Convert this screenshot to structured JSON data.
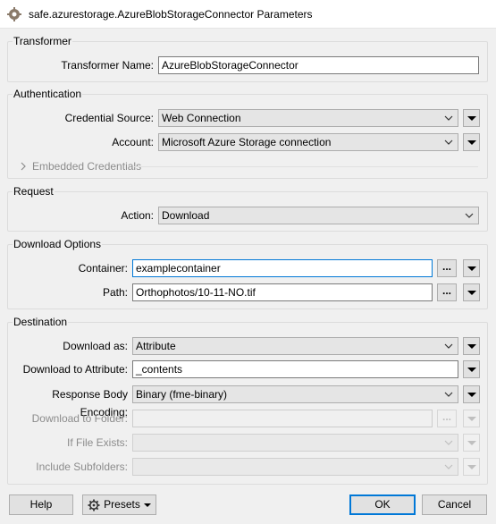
{
  "window": {
    "title": "safe.azurestorage.AzureBlobStorageConnector Parameters"
  },
  "transformer": {
    "legend": "Transformer",
    "name_label": "Transformer Name:",
    "name_value": "AzureBlobStorageConnector"
  },
  "authentication": {
    "legend": "Authentication",
    "credential_source_label": "Credential Source:",
    "credential_source_value": "Web Connection",
    "account_label": "Account:",
    "account_value": "Microsoft Azure Storage connection",
    "embedded_credentials_label": "Embedded Credentials"
  },
  "request": {
    "legend": "Request",
    "action_label": "Action:",
    "action_value": "Download"
  },
  "download_options": {
    "legend": "Download Options",
    "container_label": "Container:",
    "container_value": "examplecontainer",
    "path_label": "Path:",
    "path_value": "Orthophotos/10-11-NO.tif",
    "browse_label": "..."
  },
  "destination": {
    "legend": "Destination",
    "download_as_label": "Download as:",
    "download_as_value": "Attribute",
    "download_to_attribute_label": "Download to Attribute:",
    "download_to_attribute_value": "_contents",
    "response_body_encoding_label": "Response Body Encoding:",
    "response_body_encoding_value": "Binary (fme-binary)",
    "download_to_folder_label": "Download to Folder:",
    "download_to_folder_value": "",
    "if_file_exists_label": "If File Exists:",
    "if_file_exists_value": "",
    "include_subfolders_label": "Include Subfolders:",
    "include_subfolders_value": ""
  },
  "footer": {
    "help_label": "Help",
    "presets_label": "Presets",
    "ok_label": "OK",
    "cancel_label": "Cancel"
  },
  "colors": {
    "focus_border": "#0078d7",
    "disabled_text": "#8c8c8c"
  }
}
